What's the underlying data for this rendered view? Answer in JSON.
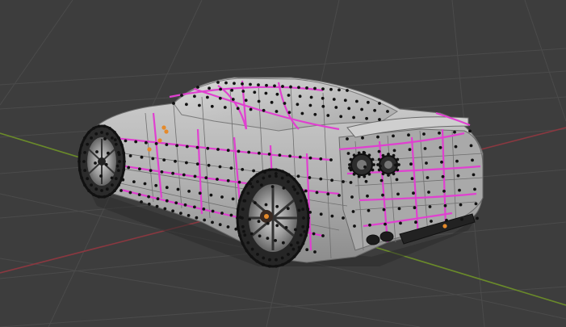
{
  "viewport": {
    "background": "#3d3d3d",
    "grid_color": "#4b4b4b",
    "axis_x_color": "#8a3840",
    "axis_y_color": "#6a8a2a"
  },
  "model": {
    "body_color": "#b7b7b7",
    "body_shade_color": "#8f8f8f",
    "selection_edge_color": "#e040d0",
    "vertex_color": "#111111",
    "active_vertex_color": "#e58a2a"
  }
}
